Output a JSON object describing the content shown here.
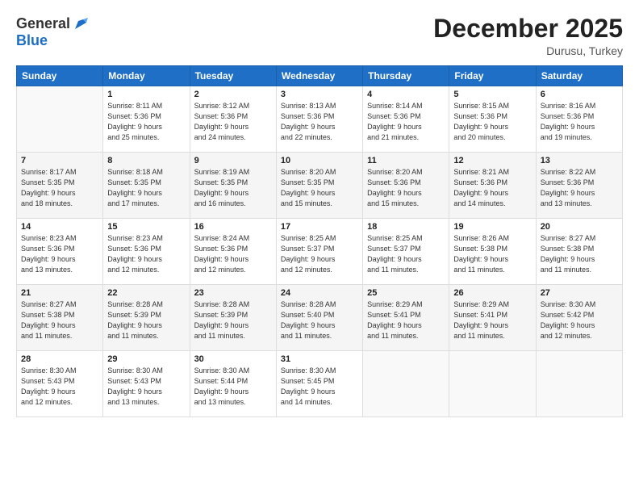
{
  "header": {
    "logo_general": "General",
    "logo_blue": "Blue",
    "month_title": "December 2025",
    "location": "Durusu, Turkey"
  },
  "days_of_week": [
    "Sunday",
    "Monday",
    "Tuesday",
    "Wednesday",
    "Thursday",
    "Friday",
    "Saturday"
  ],
  "weeks": [
    [
      {
        "day": "",
        "info": ""
      },
      {
        "day": "1",
        "info": "Sunrise: 8:11 AM\nSunset: 5:36 PM\nDaylight: 9 hours\nand 25 minutes."
      },
      {
        "day": "2",
        "info": "Sunrise: 8:12 AM\nSunset: 5:36 PM\nDaylight: 9 hours\nand 24 minutes."
      },
      {
        "day": "3",
        "info": "Sunrise: 8:13 AM\nSunset: 5:36 PM\nDaylight: 9 hours\nand 22 minutes."
      },
      {
        "day": "4",
        "info": "Sunrise: 8:14 AM\nSunset: 5:36 PM\nDaylight: 9 hours\nand 21 minutes."
      },
      {
        "day": "5",
        "info": "Sunrise: 8:15 AM\nSunset: 5:36 PM\nDaylight: 9 hours\nand 20 minutes."
      },
      {
        "day": "6",
        "info": "Sunrise: 8:16 AM\nSunset: 5:36 PM\nDaylight: 9 hours\nand 19 minutes."
      }
    ],
    [
      {
        "day": "7",
        "info": "Sunrise: 8:17 AM\nSunset: 5:35 PM\nDaylight: 9 hours\nand 18 minutes."
      },
      {
        "day": "8",
        "info": "Sunrise: 8:18 AM\nSunset: 5:35 PM\nDaylight: 9 hours\nand 17 minutes."
      },
      {
        "day": "9",
        "info": "Sunrise: 8:19 AM\nSunset: 5:35 PM\nDaylight: 9 hours\nand 16 minutes."
      },
      {
        "day": "10",
        "info": "Sunrise: 8:20 AM\nSunset: 5:35 PM\nDaylight: 9 hours\nand 15 minutes."
      },
      {
        "day": "11",
        "info": "Sunrise: 8:20 AM\nSunset: 5:36 PM\nDaylight: 9 hours\nand 15 minutes."
      },
      {
        "day": "12",
        "info": "Sunrise: 8:21 AM\nSunset: 5:36 PM\nDaylight: 9 hours\nand 14 minutes."
      },
      {
        "day": "13",
        "info": "Sunrise: 8:22 AM\nSunset: 5:36 PM\nDaylight: 9 hours\nand 13 minutes."
      }
    ],
    [
      {
        "day": "14",
        "info": "Sunrise: 8:23 AM\nSunset: 5:36 PM\nDaylight: 9 hours\nand 13 minutes."
      },
      {
        "day": "15",
        "info": "Sunrise: 8:23 AM\nSunset: 5:36 PM\nDaylight: 9 hours\nand 12 minutes."
      },
      {
        "day": "16",
        "info": "Sunrise: 8:24 AM\nSunset: 5:36 PM\nDaylight: 9 hours\nand 12 minutes."
      },
      {
        "day": "17",
        "info": "Sunrise: 8:25 AM\nSunset: 5:37 PM\nDaylight: 9 hours\nand 12 minutes."
      },
      {
        "day": "18",
        "info": "Sunrise: 8:25 AM\nSunset: 5:37 PM\nDaylight: 9 hours\nand 11 minutes."
      },
      {
        "day": "19",
        "info": "Sunrise: 8:26 AM\nSunset: 5:38 PM\nDaylight: 9 hours\nand 11 minutes."
      },
      {
        "day": "20",
        "info": "Sunrise: 8:27 AM\nSunset: 5:38 PM\nDaylight: 9 hours\nand 11 minutes."
      }
    ],
    [
      {
        "day": "21",
        "info": "Sunrise: 8:27 AM\nSunset: 5:38 PM\nDaylight: 9 hours\nand 11 minutes."
      },
      {
        "day": "22",
        "info": "Sunrise: 8:28 AM\nSunset: 5:39 PM\nDaylight: 9 hours\nand 11 minutes."
      },
      {
        "day": "23",
        "info": "Sunrise: 8:28 AM\nSunset: 5:39 PM\nDaylight: 9 hours\nand 11 minutes."
      },
      {
        "day": "24",
        "info": "Sunrise: 8:28 AM\nSunset: 5:40 PM\nDaylight: 9 hours\nand 11 minutes."
      },
      {
        "day": "25",
        "info": "Sunrise: 8:29 AM\nSunset: 5:41 PM\nDaylight: 9 hours\nand 11 minutes."
      },
      {
        "day": "26",
        "info": "Sunrise: 8:29 AM\nSunset: 5:41 PM\nDaylight: 9 hours\nand 11 minutes."
      },
      {
        "day": "27",
        "info": "Sunrise: 8:30 AM\nSunset: 5:42 PM\nDaylight: 9 hours\nand 12 minutes."
      }
    ],
    [
      {
        "day": "28",
        "info": "Sunrise: 8:30 AM\nSunset: 5:43 PM\nDaylight: 9 hours\nand 12 minutes."
      },
      {
        "day": "29",
        "info": "Sunrise: 8:30 AM\nSunset: 5:43 PM\nDaylight: 9 hours\nand 13 minutes."
      },
      {
        "day": "30",
        "info": "Sunrise: 8:30 AM\nSunset: 5:44 PM\nDaylight: 9 hours\nand 13 minutes."
      },
      {
        "day": "31",
        "info": "Sunrise: 8:30 AM\nSunset: 5:45 PM\nDaylight: 9 hours\nand 14 minutes."
      },
      {
        "day": "",
        "info": ""
      },
      {
        "day": "",
        "info": ""
      },
      {
        "day": "",
        "info": ""
      }
    ]
  ]
}
